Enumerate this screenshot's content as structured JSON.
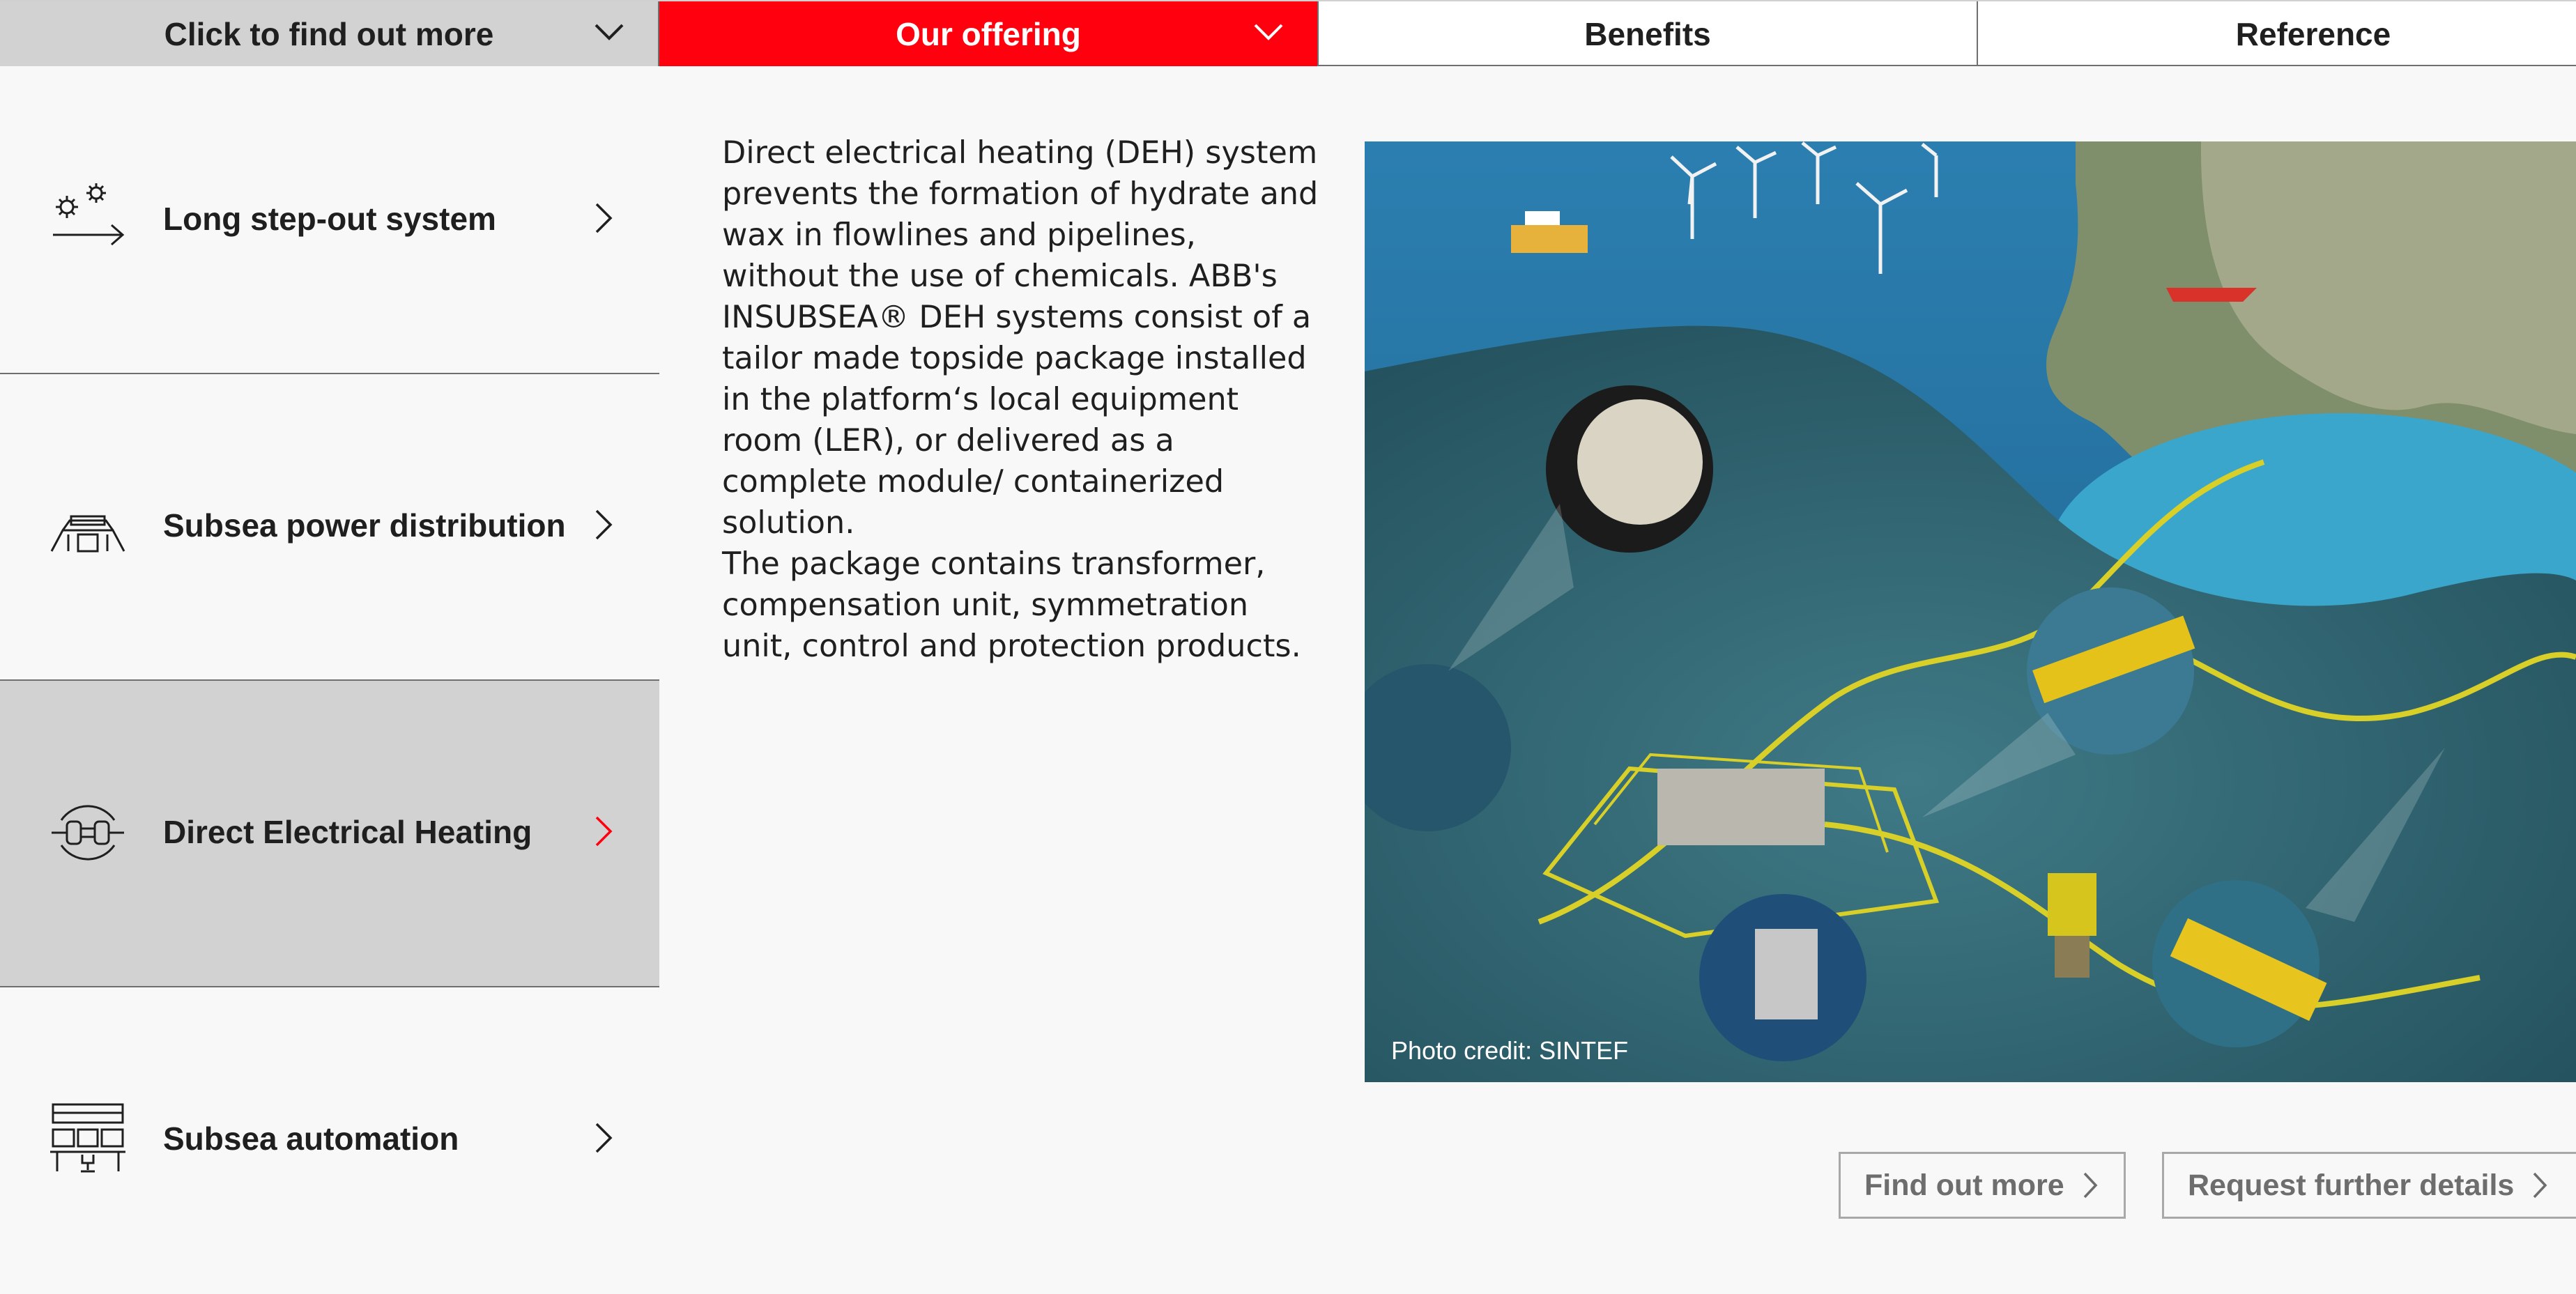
{
  "tabs": [
    {
      "label": "Click to find out more",
      "has_dropdown": true,
      "state": "grey"
    },
    {
      "label": "Our offering",
      "has_dropdown": true,
      "state": "active-red"
    },
    {
      "label": "Benefits",
      "has_dropdown": false,
      "state": "default"
    },
    {
      "label": "Reference",
      "has_dropdown": false,
      "state": "default"
    }
  ],
  "menu": {
    "items": [
      {
        "label": "Long step-out system",
        "icon": "gears-arrow-icon",
        "active": false
      },
      {
        "label": "Subsea power distribution",
        "icon": "subsea-module-icon",
        "active": false
      },
      {
        "label": "Direct Electrical Heating",
        "icon": "electrical-heating-icon",
        "active": true
      },
      {
        "label": "Subsea automation",
        "icon": "control-station-icon",
        "active": false
      }
    ]
  },
  "description": {
    "paragraph1": "Direct electrical heating (DEH) system prevents the formation of hydrate and wax in flowlines and pipelines, without the use of chemicals. ABB's INSUBSEA® DEH systems consist of a tailor made topside package installed in the platform‘s local equipment room (LER), or delivered as a complete module/ containerized solution.",
    "paragraph2": "The package contains transformer, compensation unit, symmetration unit, control and protection products."
  },
  "image": {
    "credit": "Photo credit: SINTEF"
  },
  "buttons": {
    "find_out_more": "Find out more",
    "request_details": "Request further details"
  },
  "colors": {
    "accent_red": "#ff000f",
    "active_grey": "#d2d2d2",
    "background": "#f8f8f8"
  }
}
